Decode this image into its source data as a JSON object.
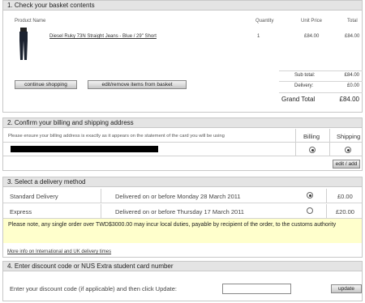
{
  "basket": {
    "title": "1. Check your basket contents",
    "headers": {
      "product": "Product Name",
      "quantity": "Quantity",
      "unit_price": "Unit Price",
      "total": "Total"
    },
    "item": {
      "name": "Diesel Ruky 73N Straight Jeans - Blue / 29\" Short",
      "quantity": "1",
      "unit_price": "£84.00",
      "total": "£84.00"
    },
    "continue_label": "continue shopping",
    "edit_label": "edit/remove items from basket",
    "subtotal_label": "Sub total:",
    "subtotal_value": "£84.00",
    "delivery_label": "Delivery:",
    "delivery_value": "£0.00",
    "grand_label": "Grand Total",
    "grand_value": "£84.00"
  },
  "address": {
    "title": "2. Confirm your billing and shipping address",
    "note": "Please ensure your billing address is exactly as it appears on the statement of the card you will be using",
    "billing_label": "Billing",
    "shipping_label": "Shipping",
    "edit_add_label": "edit / add"
  },
  "delivery": {
    "title": "3. Select a delivery method",
    "options": [
      {
        "name": "Standard Delivery",
        "eta": "Delivered on or before Monday 28 March 2011",
        "price": "£0.00",
        "selected": true
      },
      {
        "name": "Express",
        "eta": "Delivered on or before Thursday 17 March 2011",
        "price": "£20.00",
        "selected": false
      }
    ],
    "warning": "Please note, any single order over TWD$3000.00 may incur local duties, payable by recipient of the order, to the customs authority",
    "info_link": "More info on International and UK delivery times"
  },
  "discount": {
    "title": "4. Enter discount code or NUS Extra student card number",
    "prompt": "Enter your discount code (if applicable) and then click Update:",
    "input_value": "",
    "update_label": "update"
  },
  "icons": {
    "product_thumbnail": "jeans-thumbnail",
    "radio": "radio-button"
  }
}
